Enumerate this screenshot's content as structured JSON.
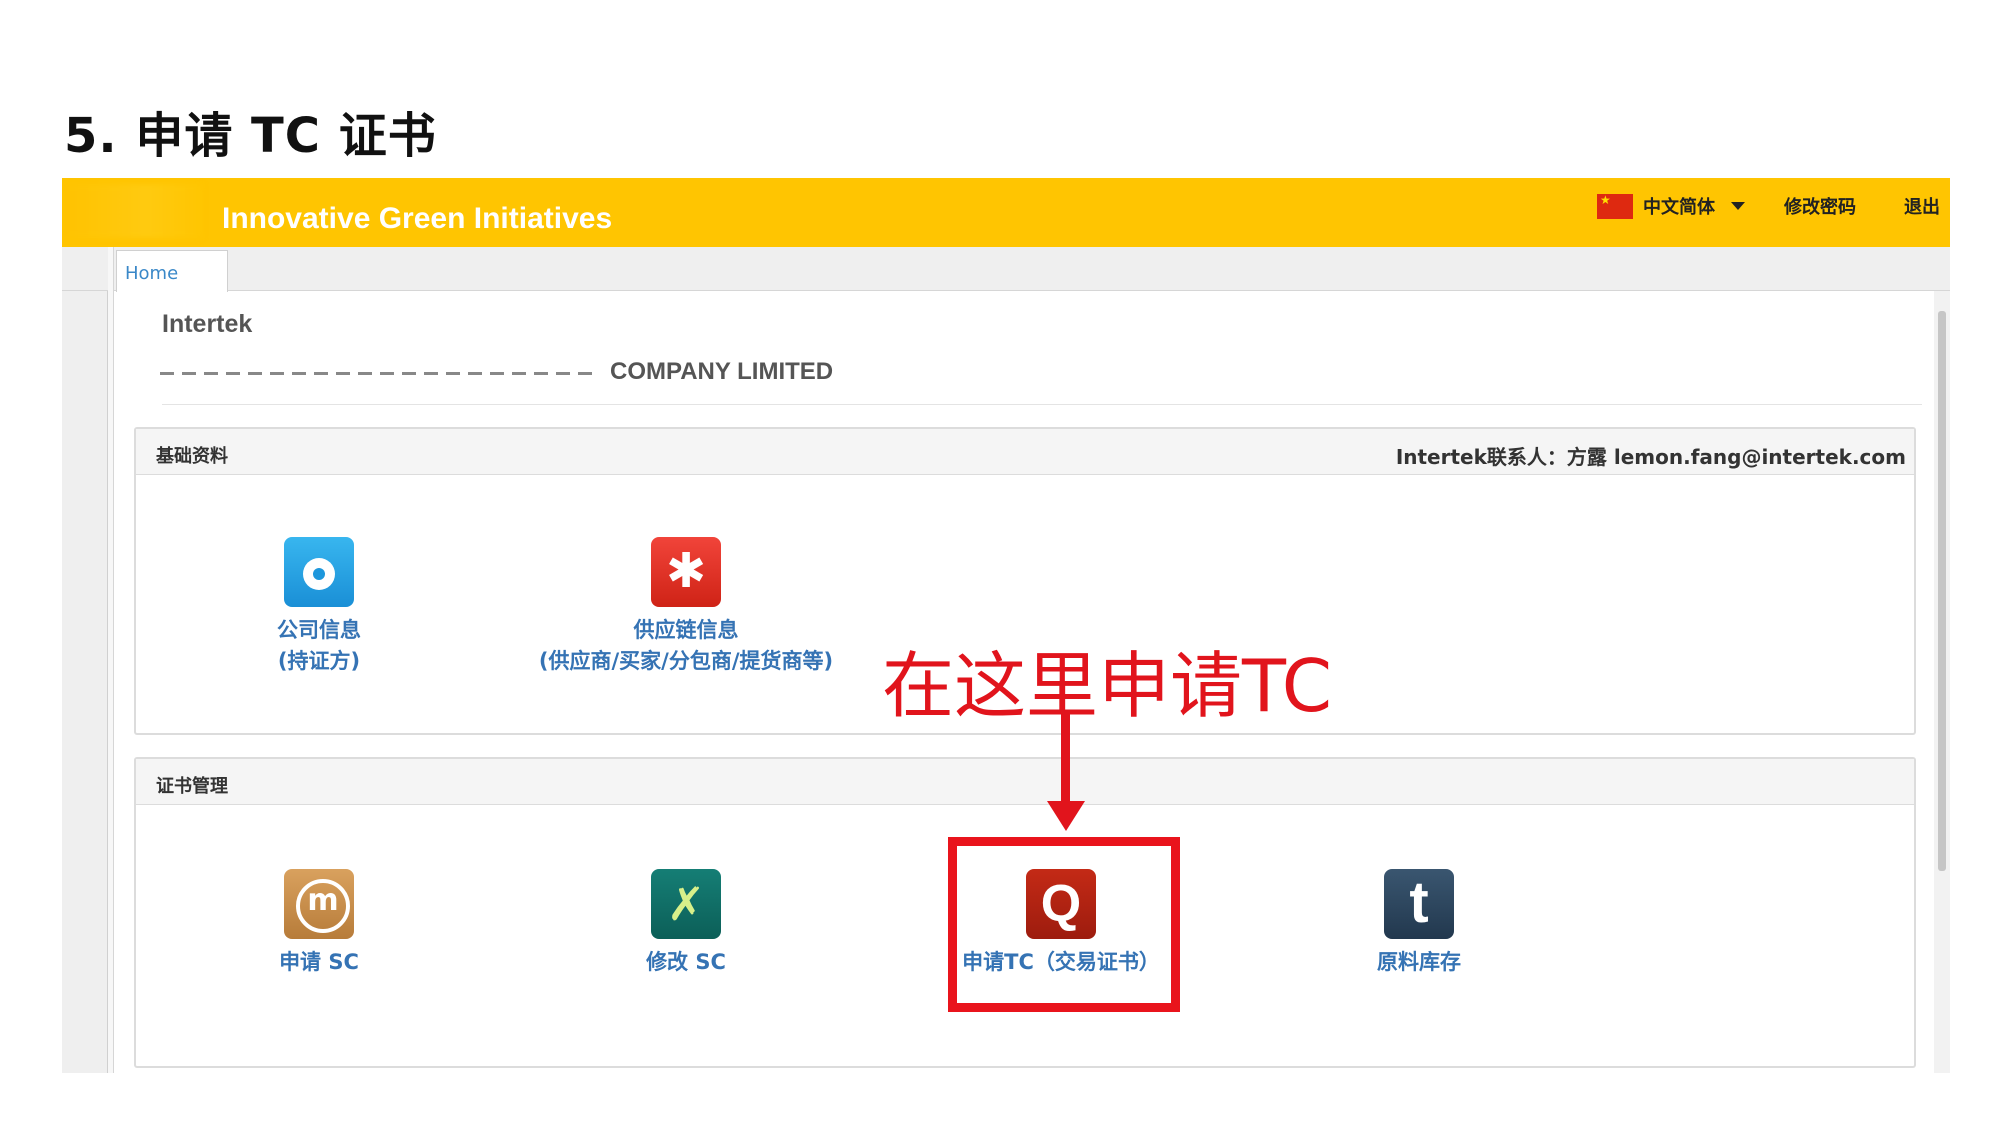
{
  "slide": {
    "title": "5. 申请 TC 证书"
  },
  "topbar": {
    "brand": "Innovative Green Initiatives",
    "language": "中文简体",
    "change_password": "修改密码",
    "logout": "退出"
  },
  "tabs": [
    {
      "label": "Home"
    }
  ],
  "header": {
    "company": "Intertek",
    "member_suffix": "COMPANY LIMITED"
  },
  "panels": {
    "basic": {
      "title": "基础资料",
      "contact": "Intertek联系人：方露 lemon.fang@intertek.com",
      "tiles": [
        {
          "line1": "公司信息",
          "line2": "(持证方)",
          "icon": "company-info-icon"
        },
        {
          "line1": "供应链信息",
          "line2": "(供应商/买家/分包商/提货商等)",
          "icon": "supply-chain-icon"
        }
      ]
    },
    "cert": {
      "title": "证书管理",
      "tiles": [
        {
          "line1": "申请 SC",
          "icon": "apply-sc-icon"
        },
        {
          "line1": "修改 SC",
          "icon": "edit-sc-icon"
        },
        {
          "line1": "申请TC（交易证书）",
          "icon": "apply-tc-icon"
        },
        {
          "line1": "原料库存",
          "icon": "inventory-icon"
        }
      ]
    }
  },
  "annotation": {
    "text": "在这里申请TC"
  },
  "colors": {
    "topbar": "#ffc501",
    "link": "#3573b4",
    "annotation": "#e1141c"
  }
}
